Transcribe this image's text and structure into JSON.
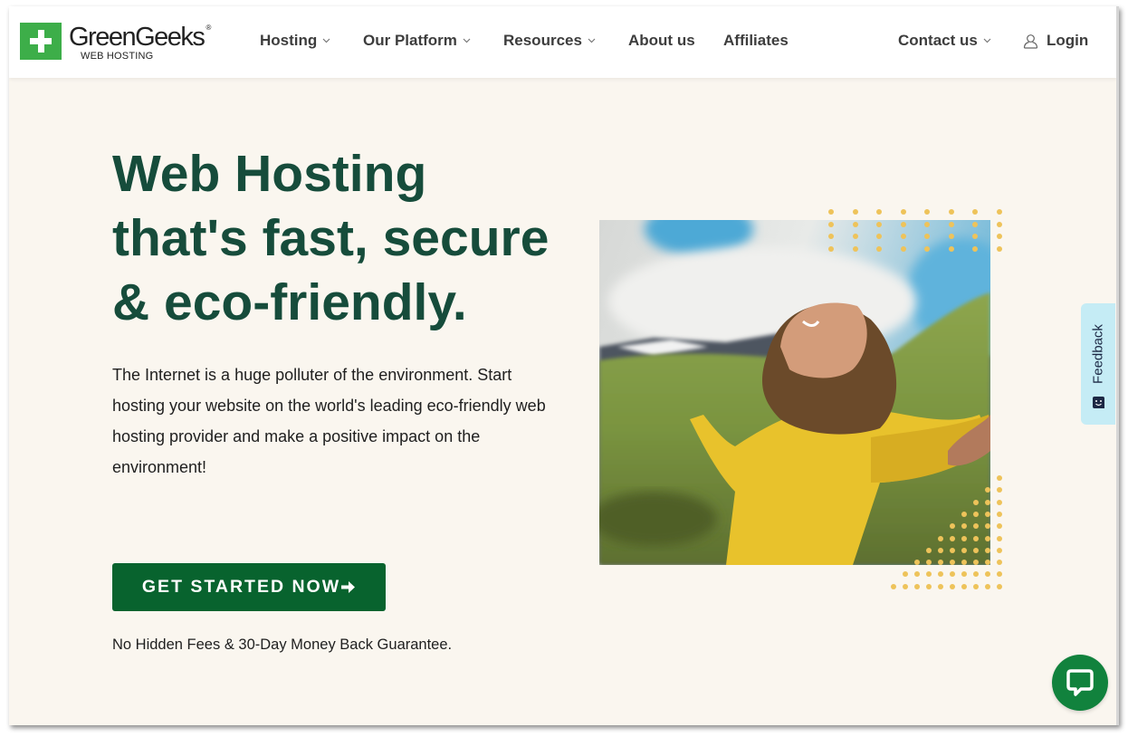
{
  "brand": {
    "name": "GreenGeeks",
    "registered_mark": "®",
    "tagline": "WEB HOSTING",
    "logo_color": "#3dae49"
  },
  "nav": {
    "items": [
      {
        "label": "Hosting",
        "has_dropdown": true
      },
      {
        "label": "Our Platform",
        "has_dropdown": true
      },
      {
        "label": "Resources",
        "has_dropdown": true
      },
      {
        "label": "About us",
        "has_dropdown": false
      },
      {
        "label": "Affiliates",
        "has_dropdown": false
      },
      {
        "label": "Contact us",
        "has_dropdown": true
      }
    ],
    "login_label": "Login",
    "login_icon": "user-icon"
  },
  "hero": {
    "title_lines": [
      "Web Hosting",
      "that's fast, secure",
      "& eco-friendly."
    ],
    "description": "The Internet is a huge polluter of the environment. Start hosting your website on the world's leading eco-friendly web hosting provider and make a positive impact on the environment!",
    "cta_label": "GET STARTED NOW",
    "cta_icon": "arrow-right-icon",
    "guarantee": "No Hidden Fees & 30-Day Money Back Guarantee.",
    "image_alt": "Woman in yellow jacket with outstretched arms in green mountain landscape"
  },
  "feedback": {
    "label": "Feedback",
    "icon": "smile-icon"
  },
  "chat": {
    "icon": "chat-bubble-icon"
  },
  "colors": {
    "heading": "#164c3b",
    "cta_bg": "#08632e",
    "page_bg": "#faf6ef",
    "dots": "#eec35a",
    "feedback_bg": "#c5ecf5",
    "chat_bg": "#11823d"
  }
}
